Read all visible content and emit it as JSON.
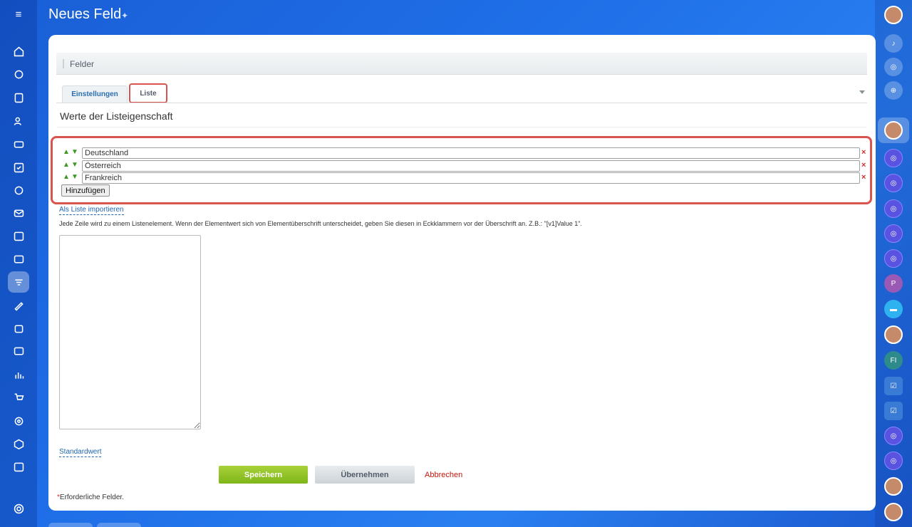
{
  "header": {
    "title": "Neues Feld"
  },
  "section": {
    "title": "Felder"
  },
  "tabs": [
    {
      "label": "Einstellungen"
    },
    {
      "label": "Liste"
    }
  ],
  "main": {
    "heading": "Werte der Listeigenschaft",
    "items": [
      {
        "value": "Deutschland"
      },
      {
        "value": "Österreich"
      },
      {
        "value": "Frankreich"
      }
    ],
    "add_label": "Hinzufügen",
    "import_link": "Als Liste importieren",
    "hint": "Jede Zeile wird zu einem Listenelement. Wenn der Elementwert sich von Elementüberschrift unterscheidet, geben Sie diesen in Eckklammern vor der Überschrift an. Z.B.: \"[v1]Value 1\".",
    "default_link": "Standardwert"
  },
  "actions": {
    "save": "Speichern",
    "apply": "Übernehmen",
    "cancel": "Abbrechen"
  },
  "footer": {
    "required_star": "*",
    "required": "Erforderliche Felder."
  },
  "right_bar": {
    "p_initial": "P",
    "fi_initial": "FI"
  },
  "colors": {
    "accent": "#2067b0",
    "save": "#8dc124",
    "highlight": "#d9534f"
  }
}
